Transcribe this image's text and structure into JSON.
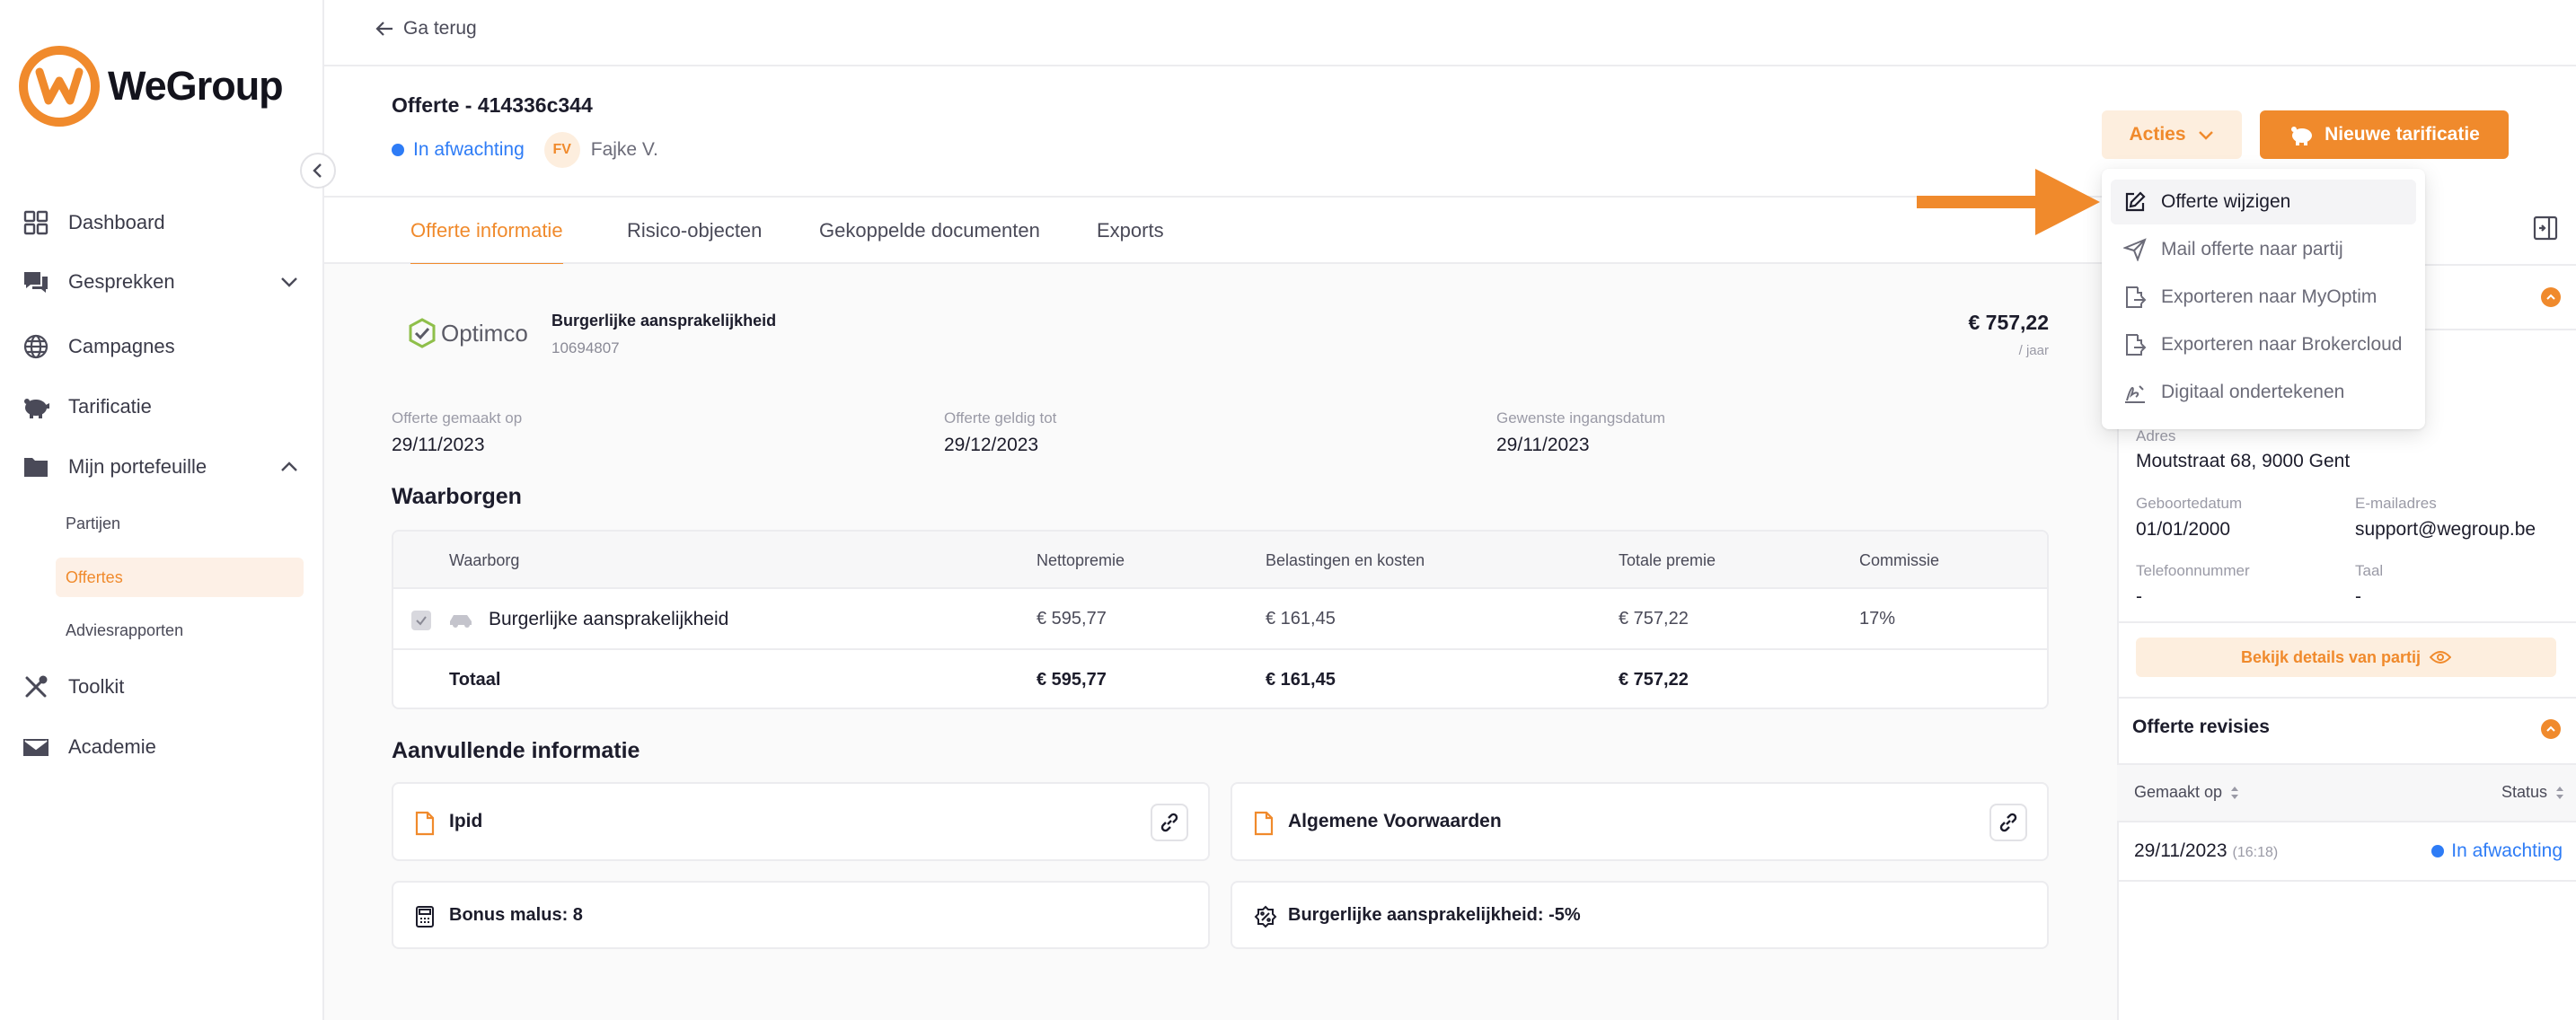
{
  "app": {
    "name": "WeGroup",
    "brand_color": "#f08a2c",
    "link_color": "#2e7cf6"
  },
  "sidebar": {
    "items": [
      {
        "label": "Dashboard",
        "icon": "grid-icon"
      },
      {
        "label": "Gesprekken",
        "icon": "chat-icon"
      },
      {
        "label": "Campagnes",
        "icon": "globe-icon"
      },
      {
        "label": "Tarificatie",
        "icon": "piggy-bank-icon"
      },
      {
        "label": "Mijn portefeuille",
        "icon": "folder-icon"
      },
      {
        "label": "Toolkit",
        "icon": "tools-icon"
      },
      {
        "label": "Academie",
        "icon": "mail-icon"
      }
    ],
    "subitems": [
      {
        "label": "Partijen"
      },
      {
        "label": "Offertes",
        "active": true
      },
      {
        "label": "Adviesrapporten"
      }
    ]
  },
  "topbar": {
    "back_label": "Ga terug"
  },
  "header": {
    "title": "Offerte - 414336c344",
    "status": "In afwachting",
    "owner_initials": "FV",
    "owner_name": "Fajke V.",
    "actions_label": "Acties",
    "new_label": "Nieuwe tarificatie"
  },
  "tabs": [
    {
      "label": "Offerte informatie",
      "active": true
    },
    {
      "label": "Risico-objecten"
    },
    {
      "label": "Gekoppelde documenten"
    },
    {
      "label": "Exports"
    }
  ],
  "offer": {
    "insurer": "Optimco",
    "product": "Burgerlijke aansprakelijkheid",
    "product_id": "10694807",
    "price": "€ 757,22",
    "period": "/ jaar",
    "meta": [
      {
        "label": "Offerte gemaakt op",
        "value": "29/11/2023"
      },
      {
        "label": "Offerte geldig tot",
        "value": "29/12/2023"
      },
      {
        "label": "Gewenste ingangsdatum",
        "value": "29/11/2023"
      }
    ]
  },
  "guarantees": {
    "title": "Waarborgen",
    "columns": [
      "Waarborg",
      "Nettopremie",
      "Belastingen en kosten",
      "Totale premie",
      "Commissie"
    ],
    "rows": [
      [
        "Burgerlijke aansprakelijkheid",
        "€ 595,77",
        "€ 161,45",
        "€ 757,22",
        "17%"
      ]
    ],
    "total": [
      "Totaal",
      "€ 595,77",
      "€ 161,45",
      "€ 757,22"
    ]
  },
  "additional": {
    "title": "Aanvullende informatie",
    "documents": [
      "Ipid",
      "Algemene Voorwaarden"
    ],
    "info": [
      "Bonus malus: 8",
      "Burgerlijke aansprakelijkheid: -5%"
    ]
  },
  "party": {
    "address_label": "Adres",
    "address": "Moutstraat 68, 9000 Gent",
    "birth_label": "Geboortedatum",
    "birth": "01/01/2000",
    "email_label": "E-mailadres",
    "email": "support@wegroup.be",
    "phone_label": "Telefoonnummer",
    "phone": "-",
    "lang_label": "Taal",
    "lang": "-",
    "details_button": "Bekijk details van partij"
  },
  "revisions": {
    "title": "Offerte revisies",
    "col_created": "Gemaakt op",
    "col_status": "Status",
    "rows": [
      {
        "date": "29/11/2023",
        "time": "(16:18)",
        "status": "In afwachting"
      }
    ]
  },
  "dropdown": {
    "items": [
      {
        "label": "Offerte wijzigen",
        "icon": "edit-icon"
      },
      {
        "label": "Mail offerte naar partij",
        "icon": "send-icon"
      },
      {
        "label": "Exporteren naar MyOptim",
        "icon": "file-export-icon"
      },
      {
        "label": "Exporteren naar Brokercloud",
        "icon": "file-export-icon"
      },
      {
        "label": "Digitaal ondertekenen",
        "icon": "signature-icon"
      }
    ]
  }
}
